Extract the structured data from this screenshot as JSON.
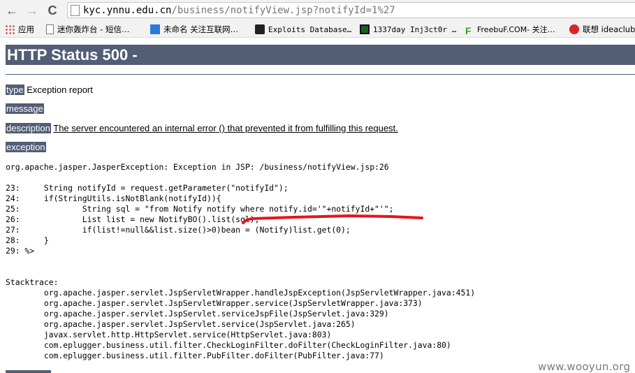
{
  "browser": {
    "nav": {
      "back": "←",
      "forward": "→",
      "reload": "C"
    },
    "url": {
      "host": "kyc.ynnu.edu.cn",
      "path": "/business/notifyView.jsp?notifyId=1%27"
    },
    "bookmarks": [
      {
        "label": "应用",
        "icon": "apps-icon"
      },
      {
        "label": "迷你轰炸台 - 短信…",
        "icon": "page-icon"
      },
      {
        "label": "未命名 关注互联网…",
        "icon": "me-icon"
      },
      {
        "label": "Exploits Database…",
        "icon": "exploit-db-icon"
      },
      {
        "label": "1337day Inj3ct0r …",
        "icon": "1337day-icon"
      },
      {
        "label": "FreebuF.COM- 关注…",
        "icon": "freebuf-icon"
      },
      {
        "label": "联想 ideaclub",
        "icon": "lenovo-icon"
      }
    ]
  },
  "page": {
    "title": "HTTP Status 500 -",
    "type_label": "type",
    "type_value": "Exception report",
    "message_label": "message",
    "description_label": "description",
    "description_value": "The server encountered an internal error () that prevented it from fulfilling this request.",
    "exception_label": "exception",
    "exception_text": "org.apache.jasper.JasperException: Exception in JSP: /business/notifyView.jsp:26\n\n23:     String notifyId = request.getParameter(\"notifyId\");\n24:     if(StringUtils.isNotBlank(notifyId)){\n25:             String sql = \"from Notify notify where notify.id='\"+notifyId+\"'\";\n26:             List list = new NotifyBO().list(sql);\n27:             if(list!=null&&list.size()>0)bean = (Notify)list.get(0);\n28:     }\n29: %>\n\n\nStacktrace:\n        org.apache.jasper.servlet.JspServletWrapper.handleJspException(JspServletWrapper.java:451)\n        org.apache.jasper.servlet.JspServletWrapper.service(JspServletWrapper.java:373)\n        org.apache.jasper.servlet.JspServlet.serviceJspFile(JspServlet.java:329)\n        org.apache.jasper.servlet.JspServlet.service(JspServlet.java:265)\n        javax.servlet.http.HttpServlet.service(HttpServlet.java:803)\n        com.eplugger.business.util.filter.CheckLoginFilter.doFilter(CheckLoginFilter.java:80)\n        com.eplugger.business.util.filter.PubFilter.doFilter(PubFilter.java:77)"
  },
  "watermark": "www.wooyun.org",
  "colors": {
    "header_bg": "#525d76",
    "annotation": "#e8141c"
  }
}
